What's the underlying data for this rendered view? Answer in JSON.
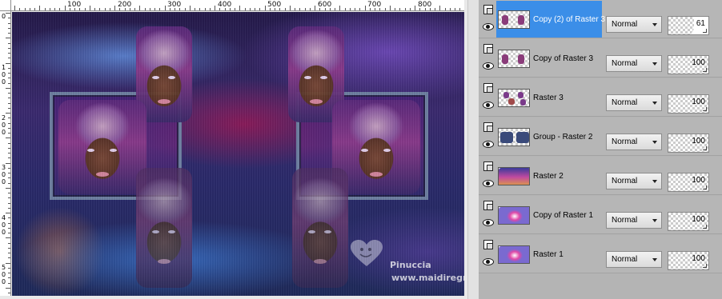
{
  "ruler_top": {
    "labels": [
      "100",
      "200",
      "300",
      "400",
      "500",
      "600",
      "700",
      "800"
    ]
  },
  "ruler_left": {
    "labels": [
      "0",
      "100",
      "200",
      "300",
      "400",
      "500"
    ]
  },
  "canvas": {
    "watermark_name": "Pinuccia",
    "watermark_url": "www.maidiregrafica.eu"
  },
  "layers": [
    {
      "name": "Copy (2) of Raster 3",
      "blend_mode": "Normal",
      "opacity": 61,
      "selected": true,
      "thumb": "portraits-pair"
    },
    {
      "name": "Copy of Raster 3",
      "blend_mode": "Normal",
      "opacity": 100,
      "selected": false,
      "thumb": "portraits-pair"
    },
    {
      "name": "Raster 3",
      "blend_mode": "Normal",
      "opacity": 100,
      "selected": false,
      "thumb": "portraits-quad"
    },
    {
      "name": "Group - Raster 2",
      "blend_mode": "Normal",
      "opacity": 100,
      "selected": false,
      "thumb": "frames"
    },
    {
      "name": "Raster 2",
      "blend_mode": "Normal",
      "opacity": 100,
      "selected": false,
      "thumb": "composite"
    },
    {
      "name": "Copy of Raster 1",
      "blend_mode": "Normal",
      "opacity": 100,
      "selected": false,
      "thumb": "gradient"
    },
    {
      "name": "Raster 1",
      "blend_mode": "Normal",
      "opacity": 100,
      "selected": false,
      "thumb": "gradient"
    }
  ],
  "colors": {
    "selection": "#3b8ee8",
    "panel": "#b4b4b4"
  }
}
